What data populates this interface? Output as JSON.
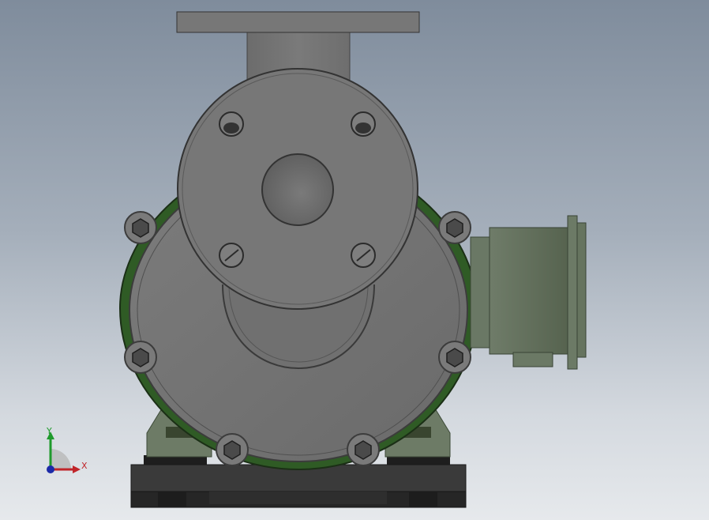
{
  "scene": {
    "subject": "pump",
    "colors": {
      "background_top": "#7f8c9c",
      "background_bottom": "#e6e9ec",
      "casing": "#777777",
      "casing_edge": "#3c3c3c",
      "bracket_green": "#2e5a24",
      "motor_box": "#5d6b58",
      "base": "#2a2a2a"
    }
  },
  "triad": {
    "x_label": "X",
    "y_label": "Y",
    "x_color": "#c0252a",
    "y_color": "#1f9a2c",
    "z_color": "#1c2aa8"
  }
}
